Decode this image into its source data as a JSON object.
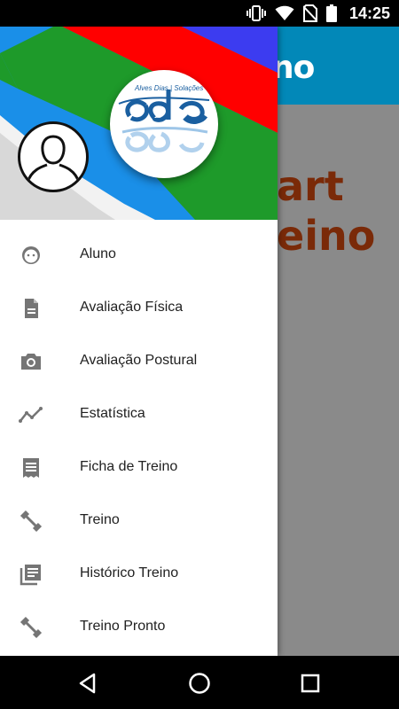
{
  "status_bar": {
    "time": "14:25",
    "icons": [
      "vibrate-icon",
      "wifi-icon",
      "no-sim-icon",
      "battery-icon"
    ]
  },
  "app_background": {
    "toolbar_title_fragment": "no",
    "brand_line_1": "art",
    "brand_line_2": "eino",
    "colors": {
      "toolbar": "#0288b8",
      "scrim": "#8a8a8a",
      "brand": "#7a2a08"
    }
  },
  "drawer": {
    "header": {
      "logo_text": "Alves Dias | Solações",
      "colors": {
        "red": "#ff0000",
        "green": "#1e9a2a",
        "blue": "#1a8fe8",
        "indigo": "#3c3cf0"
      }
    },
    "items": [
      {
        "label": "Aluno",
        "icon": "face-icon"
      },
      {
        "label": "Avaliação Física",
        "icon": "document-icon"
      },
      {
        "label": "Avaliação Postural",
        "icon": "camera-icon"
      },
      {
        "label": "Estatística",
        "icon": "trending-icon"
      },
      {
        "label": "Ficha de Treino",
        "icon": "receipt-icon"
      },
      {
        "label": "Treino",
        "icon": "dumbbell-icon"
      },
      {
        "label": "Histórico Treino",
        "icon": "library-books-icon"
      },
      {
        "label": "Treino Pronto",
        "icon": "dumbbell-icon"
      }
    ]
  },
  "nav_bar": {
    "buttons": [
      "back-icon",
      "home-icon",
      "recents-icon"
    ]
  }
}
